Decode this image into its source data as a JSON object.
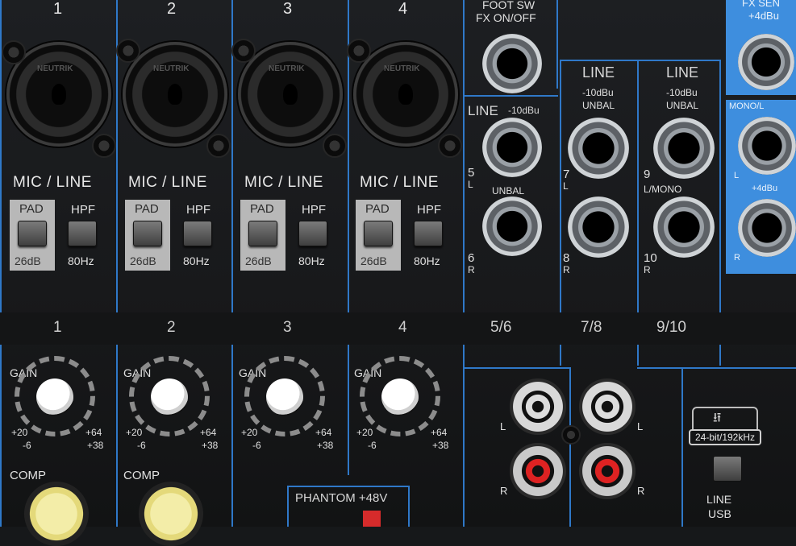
{
  "top_channel_numbers": [
    "1",
    "2",
    "3",
    "4"
  ],
  "mic_line_label": "MIC / LINE",
  "pad": {
    "label": "PAD",
    "value": "26dB"
  },
  "hpf": {
    "label": "HPF",
    "value": "80Hz"
  },
  "foot_sw": {
    "line1": "FOOT SW",
    "line2": "FX ON/OFF"
  },
  "fx_send": {
    "line1": "FX SEN",
    "line2": "+4dBu"
  },
  "line_56": {
    "title": "LINE",
    "level": "-10dBu",
    "unbal": "UNBAL",
    "jack_top": "5",
    "jack_top_side": "L",
    "jack_bottom": "6",
    "jack_bottom_side": "R"
  },
  "line_78": {
    "title": "LINE",
    "level": "-10dBu",
    "unbal": "UNBAL",
    "jack_top": "7",
    "jack_top_side": "L",
    "jack_bottom": "8",
    "jack_bottom_side": "R"
  },
  "line_910": {
    "title": "LINE",
    "level": "-10dBu",
    "unbal": "UNBAL",
    "jack_top": "9",
    "jack_top_side": "L/MONO",
    "jack_bottom": "10",
    "jack_bottom_side": "R"
  },
  "right_edge": {
    "mono_label": "MONO/L",
    "side_l": "L",
    "side_r": "R",
    "level": "+4dBu"
  },
  "channel_strip_numbers": [
    "1",
    "2",
    "3",
    "4",
    "5/6",
    "7/8",
    "9/10"
  ],
  "gain": {
    "label": "GAIN",
    "min_top": "+20",
    "min_bottom": "-6",
    "max_top": "+64",
    "max_bottom": "+38"
  },
  "comp_label": "COMP",
  "rca": {
    "left": "L",
    "right": "R"
  },
  "phantom_label": "PHANTOM +48V",
  "usb": {
    "spec": "24-bit/192kHz",
    "line_label": "LINE",
    "usb_label": "USB"
  },
  "xlr_brand": "NEUTRIK"
}
